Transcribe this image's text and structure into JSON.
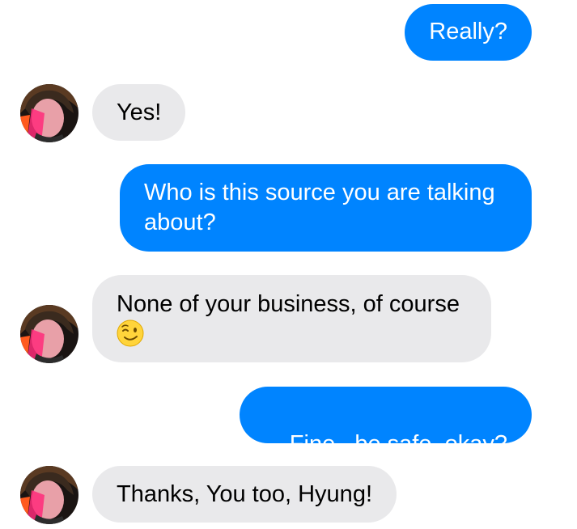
{
  "conversation": {
    "messages": [
      {
        "sender": "me",
        "text": "Really?"
      },
      {
        "sender": "contact",
        "text": "Yes!"
      },
      {
        "sender": "me",
        "text": "Who is this source you are talking about?"
      },
      {
        "sender": "contact",
        "text": "None of your business, of course",
        "emoji": "winking-face"
      },
      {
        "sender": "me",
        "text": "Fine,  be safe, okay?"
      },
      {
        "sender": "contact",
        "text": "Thanks, You too, Hyung!"
      }
    ]
  },
  "colors": {
    "sent_bubble": "#0084ff",
    "received_bubble": "#e9e9eb",
    "sent_text": "#ffffff",
    "received_text": "#000000"
  }
}
